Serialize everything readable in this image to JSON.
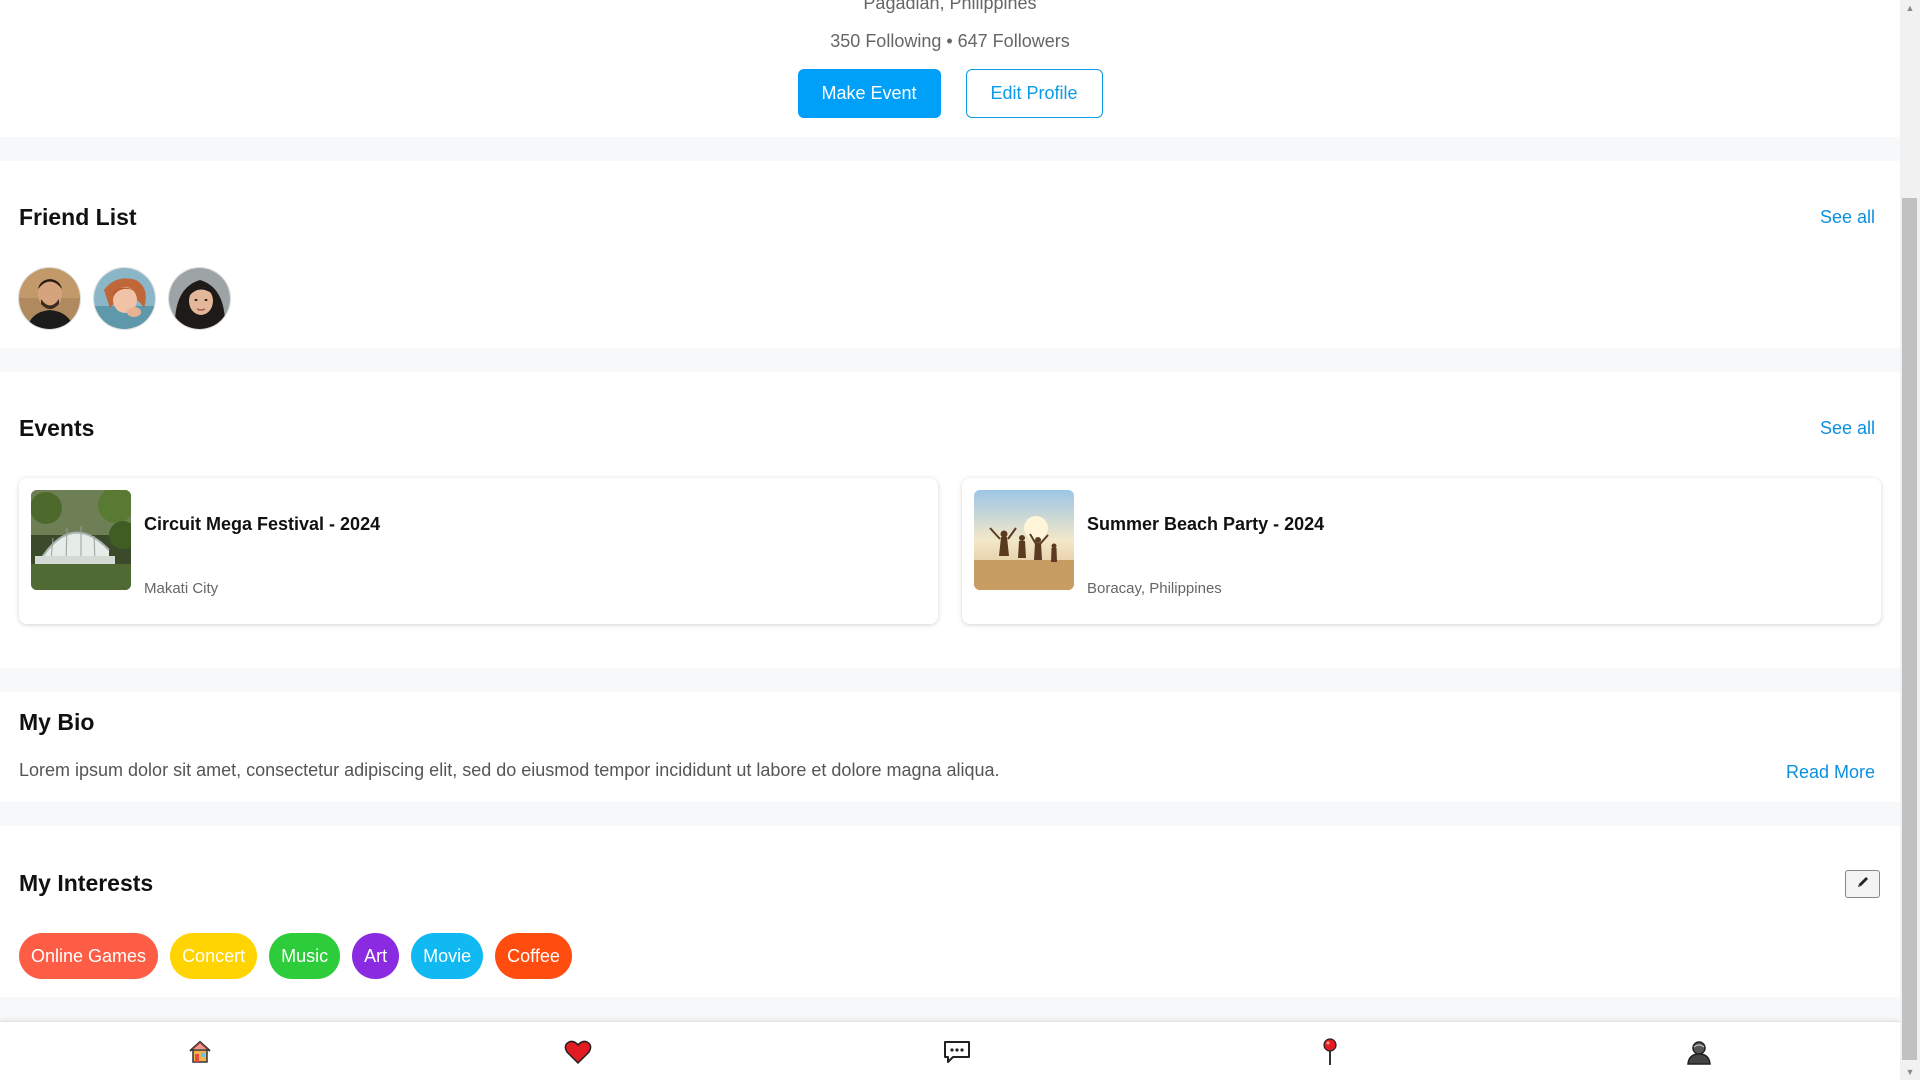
{
  "profile": {
    "location": "Pagadian, Philippines",
    "follow_stats": "350 Following • 647 Followers",
    "make_event_label": "Make Event",
    "edit_profile_label": "Edit Profile"
  },
  "friend_list": {
    "title": "Friend List",
    "see_all_label": "See all",
    "friends": [
      "avatar-1",
      "avatar-2",
      "avatar-3"
    ]
  },
  "events": {
    "title": "Events",
    "see_all_label": "See all",
    "items": [
      {
        "title": "Circuit Mega Festival - 2024",
        "location": "Makati City"
      },
      {
        "title": "Summer Beach Party - 2024",
        "location": "Boracay, Philippines"
      }
    ]
  },
  "bio": {
    "title": "My Bio",
    "text": "Lorem ipsum dolor sit amet, consectetur adipiscing elit, sed do eiusmod tempor incididunt ut labore et dolore magna aliqua.",
    "read_more_label": "Read More"
  },
  "interests": {
    "title": "My Interests",
    "edit_icon": "pencil-icon",
    "chips": [
      {
        "label": "Online Games",
        "color": "#fe5d45"
      },
      {
        "label": "Concert",
        "color": "#ffd400"
      },
      {
        "label": "Music",
        "color": "#2dcc3a"
      },
      {
        "label": "Art",
        "color": "#8a2be2"
      },
      {
        "label": "Movie",
        "color": "#10b9f2"
      },
      {
        "label": "Coffee",
        "color": "#ff4d10"
      }
    ]
  },
  "bottom_nav": {
    "items": [
      "home-icon",
      "heart-icon",
      "chat-icon",
      "map-pin-icon",
      "profile-icon"
    ]
  },
  "colors": {
    "accent": "#00a0f8",
    "link": "#0b8fe0"
  }
}
